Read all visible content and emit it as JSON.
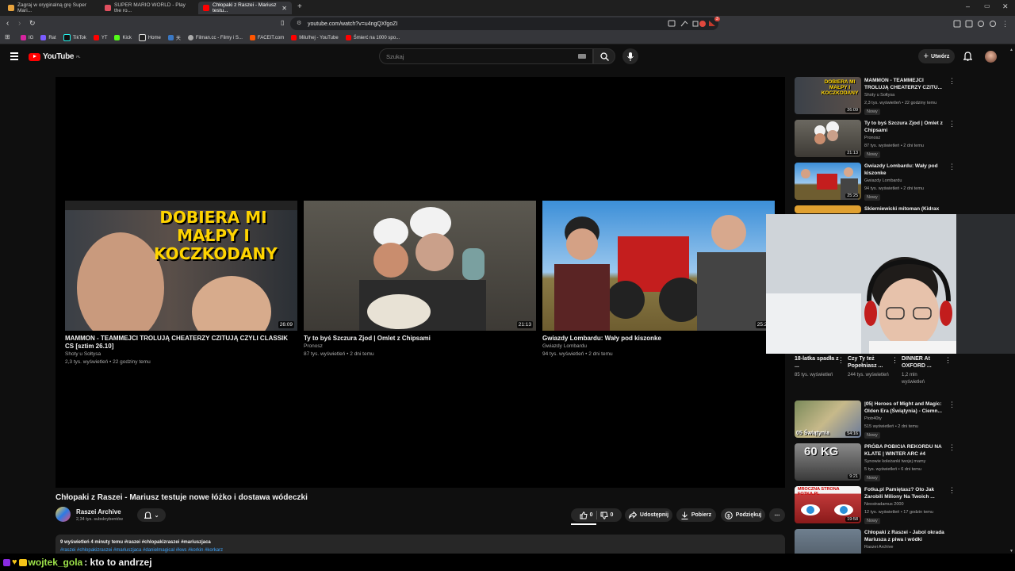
{
  "browser": {
    "tabs": [
      {
        "label": "Zagraj w oryginalną grę Super Mari...",
        "active": false
      },
      {
        "label": "SUPER MARIO WORLD - Play the ro...",
        "active": false
      },
      {
        "label": "Chłopaki z Raszei - Mariusz testu...",
        "active": true
      }
    ],
    "url": "youtube.com/watch?v=u4ngQXfgoZI",
    "extension_badge": "3",
    "bookmarks": [
      "IG",
      "Rat",
      "TikTok",
      "YT",
      "Kick",
      "Home",
      "天",
      "Filman.cc - Filmy i S...",
      "FACEIT.com",
      "Milu!hej - YouTube",
      "Śmierć na 1000 spo..."
    ]
  },
  "youtube": {
    "logo_text": "YouTube",
    "logo_region": "PL",
    "search_placeholder": "Szukaj",
    "create_label": "Utwórz",
    "colors": {
      "accent": "#ff0000",
      "link": "#3ea6ff",
      "bg": "#0f0f0f"
    }
  },
  "endscreen": [
    {
      "title": "MAMMON - TEAMMEJCI TROLUJĄ CHEATERZY CZITUJĄ CZYLI CLASSIK CS [sztim 26.10]",
      "channel": "Shoty u Sołtysa",
      "views": "2,3 tys. wyświetleń • 22 godziny temu",
      "duration": "26:09",
      "overlay_text": "DOBIERA MI MAŁPY I KOCZKODANY"
    },
    {
      "title": "Ty to byś Szczura Zjod | Omlet z Chipsami",
      "channel": "Pronosz",
      "views": "87 tys. wyświetleń • 2 dni temu",
      "duration": "21:13"
    },
    {
      "title": "Gwiazdy Lombardu: Wały pod kiszonke",
      "channel": "Gwiazdy Lombardu",
      "views": "94 tys. wyświetleń • 2 dni temu",
      "duration": "25:25"
    }
  ],
  "video": {
    "title": "Chłopaki z Raszei - Mariusz testuje nowe łóżko i dostawa wódeczki",
    "channel": "Raszei Archive",
    "subscribers": "2,34 tys. subskrybentów",
    "likes": "0",
    "dislikes": "0",
    "share_label": "Udostępnij",
    "download_label": "Pobierz",
    "thanks_label": "Podziękuj",
    "desc_line1": "9 wyświetleń  4 minuty temu  #raszei #chlopakizraszei #mariuszjaca",
    "desc_tags": "#raszei #chlopakizraszei #mariuszjaca #danielmagical #kws #korkin #korkarz"
  },
  "sidebar": [
    {
      "title": "MAMMON - TEAMMEJCI TROLUJĄ CHEATERZY CZITU...",
      "channel": "Shoty u Sołtysa",
      "views": "2,3 tys. wyświetleń • 22 godziny temu",
      "badge": "Nowy",
      "duration": "26:09",
      "overlay_text": "DOBIERA MI MAŁPY I KOCZKODANY"
    },
    {
      "title": "Ty to byś Szczura Zjod | Omlet z Chipsami",
      "channel": "Pronosz",
      "views": "87 tys. wyświetleń • 2 dni temu",
      "badge": "Nowy",
      "duration": "21:13"
    },
    {
      "title": "Gwiazdy Lombardu: Wały pod kiszonke",
      "channel": "Gwiazdy Lombardu",
      "views": "94 tys. wyświetleń • 2 dni temu",
      "badge": "Nowy",
      "duration": "25:25"
    },
    {
      "title": "Skierniewicki mitoman (Kidrax",
      "channel": "",
      "views": "",
      "badge": "",
      "duration": ""
    },
    {
      "title": "|05| Heroes of Might and Magic: Olden Era (Świątynia) - Ciemn...",
      "channel": "Piotr40ty",
      "views": "515 wyświetleń • 2 dni temu",
      "badge": "Nowy",
      "duration": "54:16",
      "overlay_text": "05 Świątynia"
    },
    {
      "title": "PRÓBA POBICIA REKORDU NA KLATE | WINTER ARC #4",
      "channel": "Synowie koleżanki twojej mamy",
      "views": "5 tys. wyświetleń • 6 dni temu",
      "badge": "Nowy",
      "duration": "9:21",
      "overlay_text": "60 KG"
    },
    {
      "title": "Fotka.pl Pamiętasz? Oto Jak Zarobili Miliony Na Twoich ...",
      "channel": "Neostradamus 2000",
      "views": "12 tys. wyświetleń • 17 godzin temu",
      "badge": "Nowy",
      "duration": "19:58",
      "overlay_text": "MROCZNA STRONA FOTKA.PL"
    },
    {
      "title": "Chłopaki z Raszei - Jabol okrada Mariusza z piwa i wódki",
      "channel": "Raszei Archive",
      "views": "",
      "badge": "",
      "duration": ""
    }
  ],
  "shorts": [
    {
      "title": "18-latka spadła z ...",
      "views": "85 tys. wyświetleń"
    },
    {
      "title": "Czy Ty też Popełniasz ...",
      "views": "244 tys. wyświetleń"
    },
    {
      "title": "DINNER At OXFORD ...",
      "views": "1,2 mln wyświetleń"
    }
  ],
  "chat": {
    "username": "wojtek_gola",
    "message": ": kto to andrzej"
  }
}
